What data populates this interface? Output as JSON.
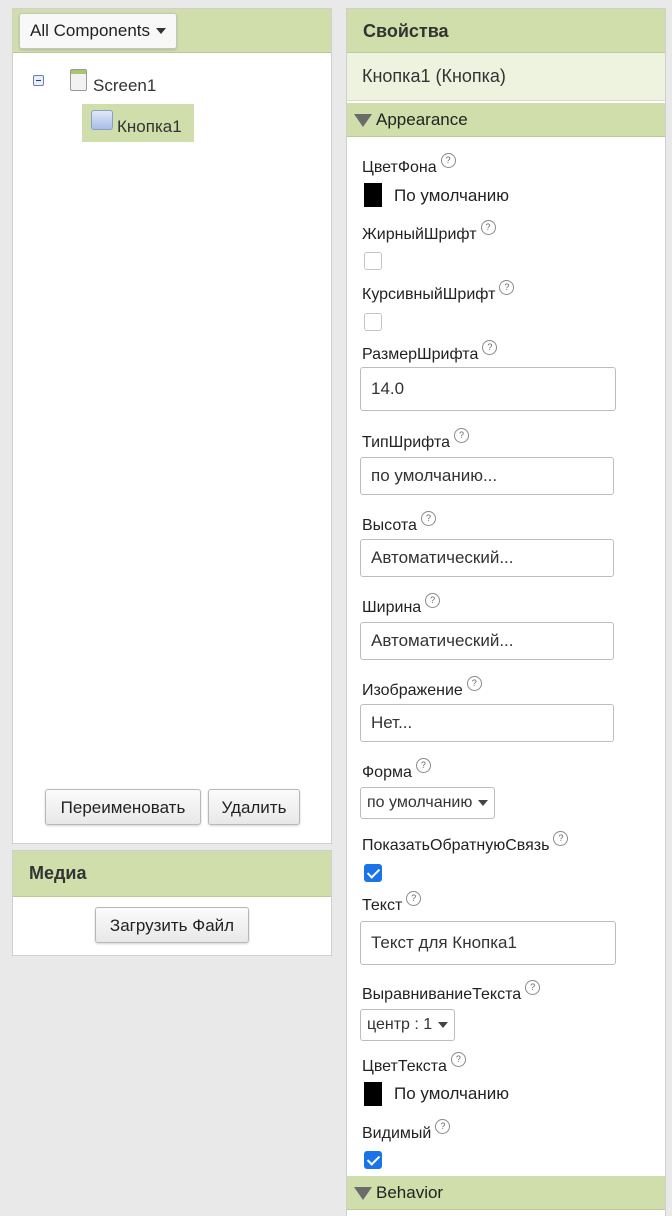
{
  "tree": {
    "dropdown_label": "All Components",
    "nodes": [
      {
        "label": "Screen1"
      },
      {
        "label": "Кнопка1"
      }
    ],
    "rename_label": "Переименовать",
    "delete_label": "Удалить"
  },
  "media": {
    "title": "Медиа",
    "upload_label": "Загрузить Файл"
  },
  "properties": {
    "title": "Свойства",
    "component": "Кнопка1 (Кнопка)",
    "sections": {
      "appearance": "Appearance",
      "behavior": "Behavior"
    },
    "help_glyph": "?",
    "bg_color": {
      "label": "ЦветФона",
      "value": "По умолчанию",
      "swatch": "#000000"
    },
    "bold": {
      "label": "ЖирныйШрифт",
      "checked": false
    },
    "italic": {
      "label": "КурсивныйШрифт",
      "checked": false
    },
    "font_size": {
      "label": "РазмерШрифта",
      "value": "14.0"
    },
    "font_type": {
      "label": "ТипШрифта",
      "value": "по умолчанию..."
    },
    "height": {
      "label": "Высота",
      "value": "Автоматический..."
    },
    "width": {
      "label": "Ширина",
      "value": "Автоматический..."
    },
    "image": {
      "label": "Изображение",
      "value": "Нет..."
    },
    "shape": {
      "label": "Форма",
      "value": "по умолчанию"
    },
    "show_feedback": {
      "label": "ПоказатьОбратнуюСвязь",
      "checked": true
    },
    "text": {
      "label": "Текст",
      "value": "Текст для Кнопка1"
    },
    "text_align": {
      "label": "ВыравниваниеТекста",
      "value": "центр : 1"
    },
    "text_color": {
      "label": "ЦветТекста",
      "value": "По умолчанию",
      "swatch": "#000000"
    },
    "visible": {
      "label": "Видимый",
      "checked": true
    }
  }
}
